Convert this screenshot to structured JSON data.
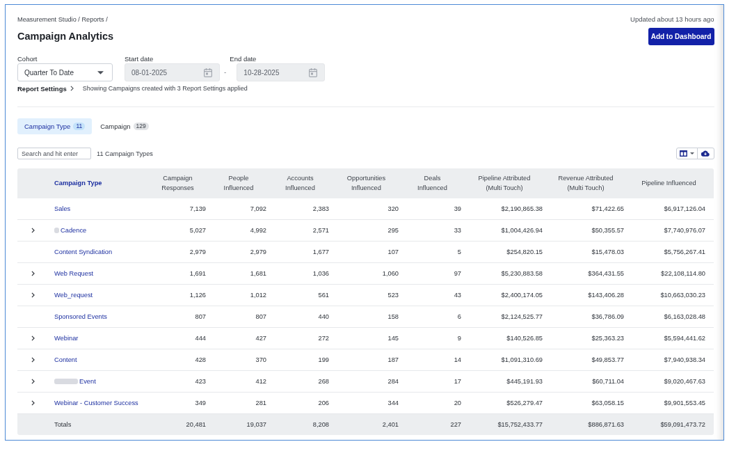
{
  "header": {
    "breadcrumb": "Measurement Studio / Reports /",
    "title": "Campaign Analytics",
    "updated": "Updated about 13 hours ago",
    "action_button": "Add to Dashboard"
  },
  "filters": {
    "cohort": {
      "label": "Cohort",
      "value": "Quarter To Date",
      "disabled": false
    },
    "start_date": {
      "label": "Start date",
      "value": "08-01-2025",
      "disabled": true
    },
    "separator": "-",
    "end_date": {
      "label": "End date",
      "value": "10-28-2025",
      "disabled": true
    }
  },
  "report_settings": {
    "link": "Report Settings",
    "summary": "Showing Campaigns created with 3 Report Settings applied"
  },
  "tabs": [
    {
      "label": "Campaign Type",
      "count": "11",
      "selected": true
    },
    {
      "label": "Campaign",
      "count": "129",
      "selected": false
    }
  ],
  "search": {
    "placeholder": "Search and hit enter"
  },
  "result_count": "11 Campaign Types",
  "table": {
    "columns": [
      {
        "kind": "label",
        "lines": [
          "Campaign Type"
        ]
      },
      {
        "kind": "metric",
        "lines": [
          "Campaign",
          "Responses"
        ]
      },
      {
        "kind": "metric",
        "lines": [
          "People",
          "Influenced"
        ]
      },
      {
        "kind": "metric",
        "lines": [
          "Accounts",
          "Influenced"
        ]
      },
      {
        "kind": "metric",
        "lines": [
          "Opportunities",
          "Influenced"
        ]
      },
      {
        "kind": "metric",
        "lines": [
          "Deals",
          "Influenced"
        ]
      },
      {
        "kind": "metric",
        "lines": [
          "Pipeline Attributed",
          "(Multi Touch)"
        ]
      },
      {
        "kind": "metric",
        "lines": [
          "Revenue Attributed",
          "(Multi Touch)"
        ]
      },
      {
        "kind": "metric",
        "lines": [
          "Pipeline Influenced"
        ]
      }
    ],
    "rows": [
      {
        "name": "Sales",
        "expandable": false,
        "kind": "plain",
        "values": [
          "7,139",
          "7,092",
          "2,383",
          "320",
          "39",
          "$2,190,865.38",
          "$71,422.65",
          "$6,917,126.04"
        ]
      },
      {
        "name": "Cadence",
        "expandable": true,
        "kind": "shortmask",
        "values": [
          "5,027",
          "4,992",
          "2,571",
          "295",
          "33",
          "$1,004,426.94",
          "$50,355.57",
          "$7,740,976.07"
        ]
      },
      {
        "name": "Content Syndication",
        "expandable": false,
        "kind": "plain",
        "values": [
          "2,979",
          "2,979",
          "1,677",
          "107",
          "5",
          "$254,820.15",
          "$15,478.03",
          "$5,756,267.41"
        ]
      },
      {
        "name": "Web Request",
        "expandable": true,
        "kind": "plain",
        "values": [
          "1,691",
          "1,681",
          "1,036",
          "1,060",
          "97",
          "$5,230,883.58",
          "$364,431.55",
          "$22,108,114.80"
        ]
      },
      {
        "name": "Web_request",
        "expandable": true,
        "kind": "plain",
        "values": [
          "1,126",
          "1,012",
          "561",
          "523",
          "43",
          "$2,400,174.05",
          "$143,406.28",
          "$10,663,030.23"
        ]
      },
      {
        "name": "Sponsored Events",
        "expandable": false,
        "kind": "plain",
        "values": [
          "807",
          "807",
          "440",
          "158",
          "6",
          "$2,124,525.77",
          "$36,786.09",
          "$6,163,028.48"
        ]
      },
      {
        "name": "Webinar",
        "expandable": true,
        "kind": "plain",
        "values": [
          "444",
          "427",
          "272",
          "145",
          "9",
          "$140,526.85",
          "$25,363.23",
          "$5,594,441.62"
        ]
      },
      {
        "name": "Content",
        "expandable": true,
        "kind": "plain",
        "values": [
          "428",
          "370",
          "199",
          "187",
          "14",
          "$1,091,310.69",
          "$49,853.77",
          "$7,940,938.34"
        ]
      },
      {
        "name": "Event",
        "expandable": true,
        "kind": "longmask",
        "values": [
          "423",
          "412",
          "268",
          "284",
          "17",
          "$445,191.93",
          "$60,711.04",
          "$9,020,467.63"
        ]
      },
      {
        "name": "Webinar - Customer Success",
        "expandable": true,
        "kind": "plain",
        "values": [
          "349",
          "281",
          "206",
          "344",
          "20",
          "$526,279.47",
          "$63,058.15",
          "$9,901,553.45"
        ]
      }
    ],
    "totals": {
      "label": "Totals",
      "values": [
        "20,481",
        "19,037",
        "8,208",
        "2,401",
        "227",
        "$15,752,433.77",
        "$886,871.63",
        "$59,091,473.72"
      ]
    }
  }
}
